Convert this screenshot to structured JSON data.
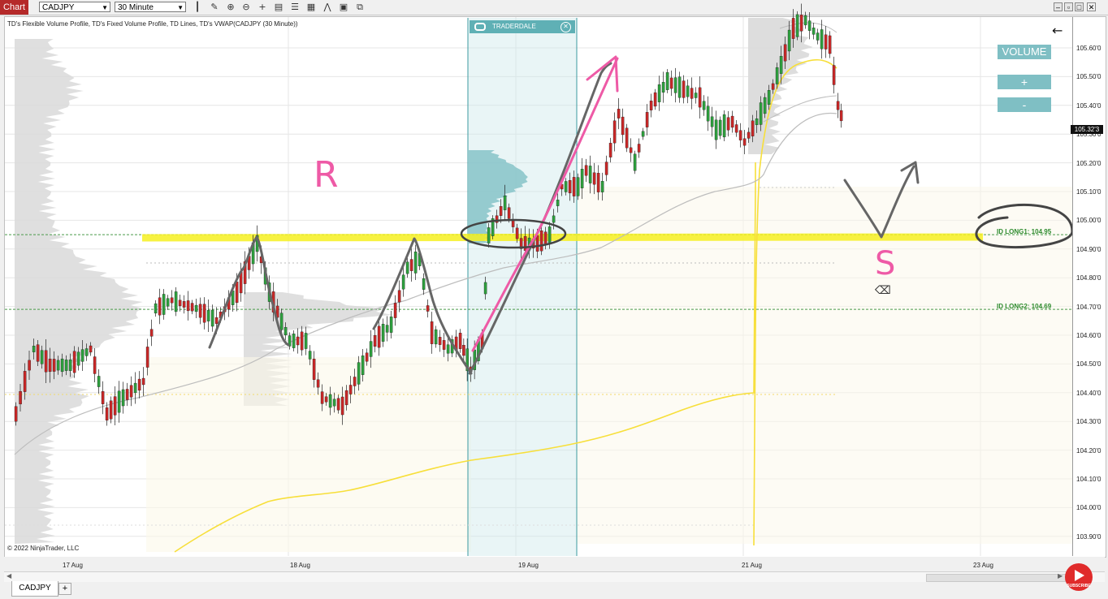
{
  "toolbar": {
    "chart_tab": "Chart",
    "instrument": "CADJPY",
    "timeframe": "30 Minute",
    "tools": [
      "bar-type-icon",
      "pencil-icon",
      "zoom-in-icon",
      "zoom-out-icon",
      "crosshair-icon",
      "data-box-icon",
      "properties-icon",
      "indicators-icon",
      "strategy-icon",
      "templates-icon",
      "attach-icon"
    ]
  },
  "chart": {
    "title": "TD's Flexible Volume Profile, TD's Fixed Volume Profile, TD Lines, TD's VWAP(CADJPY (30 Minute))",
    "copyright": "© 2022 NinjaTrader, LLC",
    "y_labels": [
      "105.60'0",
      "105.50'0",
      "105.40'0",
      "105.30'0",
      "105.20'0",
      "105.10'0",
      "105.00'0",
      "104.90'0",
      "104.80'0",
      "104.70'0",
      "104.60'0",
      "104.50'0",
      "104.40'0",
      "104.30'0",
      "104.20'0",
      "104.10'0",
      "104.00'0",
      "103.90'0"
    ],
    "current_price": "105.32'3",
    "x_labels": [
      "17 Aug",
      "18 Aug",
      "19 Aug",
      "21 Aug",
      "23 Aug"
    ],
    "levels": {
      "long1": "ID LONG1: 104.95",
      "long2": "ID LONG2: 104.69"
    },
    "logo": "TRADERDALE",
    "annotations": {
      "resistance": "R",
      "support": "S"
    }
  },
  "volume_panel": {
    "label": "VOLUME",
    "plus": "+",
    "minus": "-"
  },
  "bottom": {
    "tab": "CADJPY",
    "add": "+"
  },
  "youtube": {
    "label": "SUBSCRIBE"
  },
  "colors": {
    "bull": "#2e9e3e",
    "bear": "#c62828",
    "profile": "#d9d9d9",
    "vwap": "#f7df3a",
    "highlight": "#f6f021",
    "teal": "#5fb0b5",
    "pink": "#ee5aa6"
  },
  "chart_data": {
    "type": "candlestick",
    "ylim": [
      103.85,
      105.72
    ],
    "key_levels": [
      104.95,
      104.69
    ],
    "current_price": 105.323
  }
}
